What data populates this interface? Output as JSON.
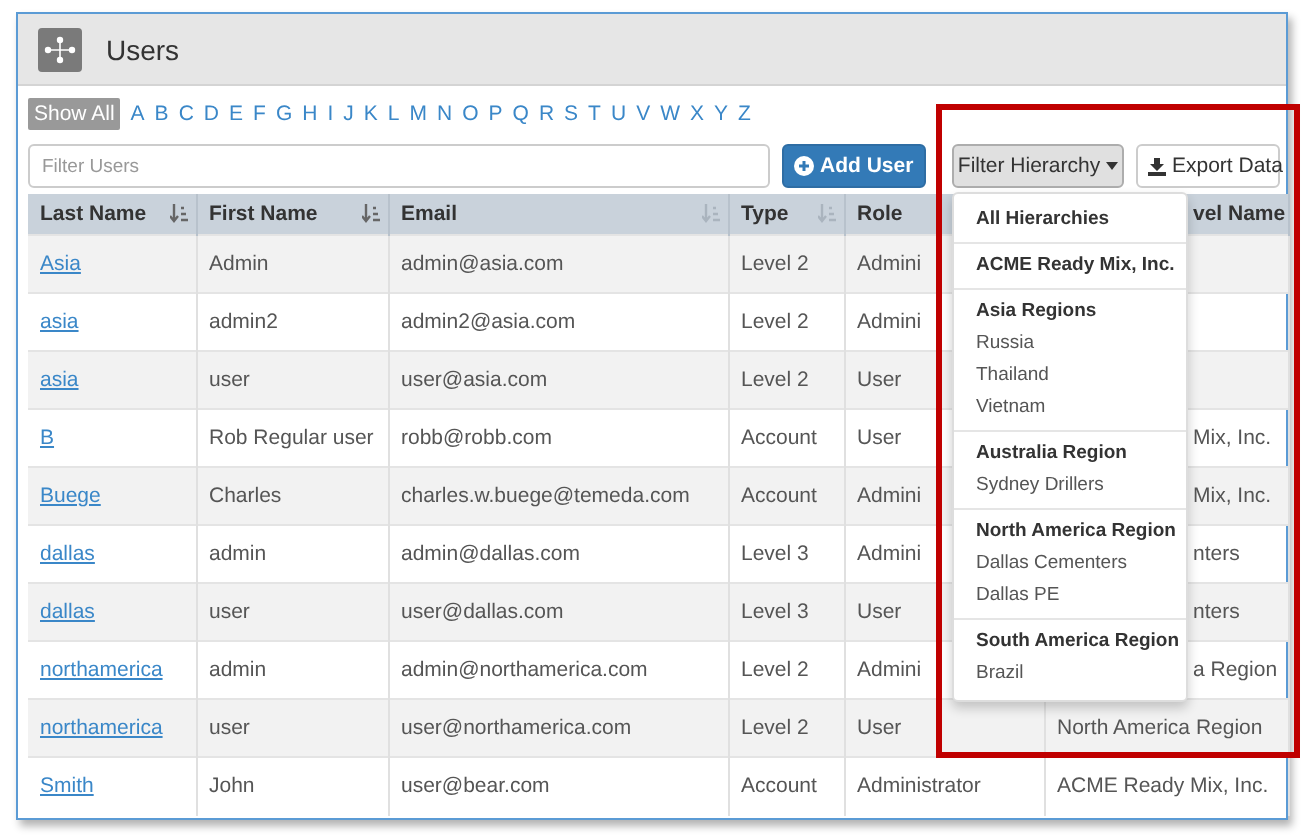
{
  "window": {
    "title": "Users"
  },
  "letters": [
    {
      "label": "Show All",
      "selected": true
    },
    {
      "label": "A",
      "selected": false
    },
    {
      "label": "B",
      "selected": false
    },
    {
      "label": "C",
      "selected": false
    },
    {
      "label": "D",
      "selected": false
    },
    {
      "label": "E",
      "selected": false
    },
    {
      "label": "F",
      "selected": false
    },
    {
      "label": "G",
      "selected": false
    },
    {
      "label": "H",
      "selected": false
    },
    {
      "label": "I",
      "selected": false
    },
    {
      "label": "J",
      "selected": false
    },
    {
      "label": "K",
      "selected": false
    },
    {
      "label": "L",
      "selected": false
    },
    {
      "label": "M",
      "selected": false
    },
    {
      "label": "N",
      "selected": false
    },
    {
      "label": "O",
      "selected": false
    },
    {
      "label": "P",
      "selected": false
    },
    {
      "label": "Q",
      "selected": false
    },
    {
      "label": "R",
      "selected": false
    },
    {
      "label": "S",
      "selected": false
    },
    {
      "label": "T",
      "selected": false
    },
    {
      "label": "U",
      "selected": false
    },
    {
      "label": "V",
      "selected": false
    },
    {
      "label": "W",
      "selected": false
    },
    {
      "label": "X",
      "selected": false
    },
    {
      "label": "Y",
      "selected": false
    },
    {
      "label": "Z",
      "selected": false
    }
  ],
  "search": {
    "placeholder": "Filter Users"
  },
  "buttons": {
    "add": "Add User",
    "filter": "Filter Hierarchy",
    "export": "Export Data"
  },
  "filter_menu": [
    {
      "label": "All Hierarchies"
    },
    {
      "label": "ACME Ready Mix, Inc."
    },
    {
      "label": "Asia Regions",
      "children": [
        {
          "label": "Russia"
        },
        {
          "label": "Thailand"
        },
        {
          "label": "Vietnam"
        }
      ]
    },
    {
      "label": "Australia Region",
      "children": [
        {
          "label": "Sydney Drillers"
        }
      ]
    },
    {
      "label": "North America Region",
      "children": [
        {
          "label": "Dallas Cementers"
        },
        {
          "label": "Dallas PE"
        }
      ]
    },
    {
      "label": "South America Region",
      "children": [
        {
          "label": "Brazil"
        }
      ]
    }
  ],
  "table": {
    "columns": [
      {
        "label": "Last Name",
        "sorted": true
      },
      {
        "label": "First Name",
        "sorted": true
      },
      {
        "label": "Email",
        "sorted": false
      },
      {
        "label": "Type",
        "sorted": false
      },
      {
        "label": "Role"
      },
      {
        "label": "vel Name",
        "covered": true
      }
    ],
    "rows": [
      {
        "last_name": "Asia",
        "first_name": "Admin",
        "email": "admin@asia.com",
        "type": "Level 2",
        "role": "Admini"
      },
      {
        "last_name": "asia",
        "first_name": "admin2",
        "email": "admin2@asia.com",
        "type": "Level 2",
        "role": "Admini"
      },
      {
        "last_name": "asia",
        "first_name": "user",
        "email": "user@asia.com",
        "type": "Level 2",
        "role": "User"
      },
      {
        "last_name": "B",
        "first_name": "Rob Regular user",
        "email": "robb@robb.com",
        "type": "Account",
        "role": "User",
        "hierarchy": "Mix, Inc.",
        "covered": true
      },
      {
        "last_name": "Buege",
        "first_name": "Charles",
        "email": "charles.w.buege@temeda.com",
        "type": "Account",
        "role": "Admini",
        "hierarchy": "Mix, Inc.",
        "covered": true
      },
      {
        "last_name": "dallas",
        "first_name": "admin",
        "email": "admin@dallas.com",
        "type": "Level 3",
        "role": "Admini",
        "hierarchy": "nters",
        "covered": true
      },
      {
        "last_name": "dallas",
        "first_name": "user",
        "email": "user@dallas.com",
        "type": "Level 3",
        "role": "User",
        "hierarchy": "nters",
        "covered": true
      },
      {
        "last_name": "northamerica",
        "first_name": "admin",
        "email": "admin@northamerica.com",
        "type": "Level 2",
        "role": "Admini",
        "hierarchy": "a Region",
        "covered": true
      },
      {
        "last_name": "northamerica",
        "first_name": "user",
        "email": "user@northamerica.com",
        "type": "Level 2",
        "role": "User",
        "hierarchy": "North America Region",
        "covered": false
      },
      {
        "last_name": "Smith",
        "first_name": "John",
        "email": "user@bear.com",
        "type": "Account",
        "role": "Administrator",
        "hierarchy": "ACME Ready Mix, Inc.",
        "covered": false
      }
    ]
  }
}
